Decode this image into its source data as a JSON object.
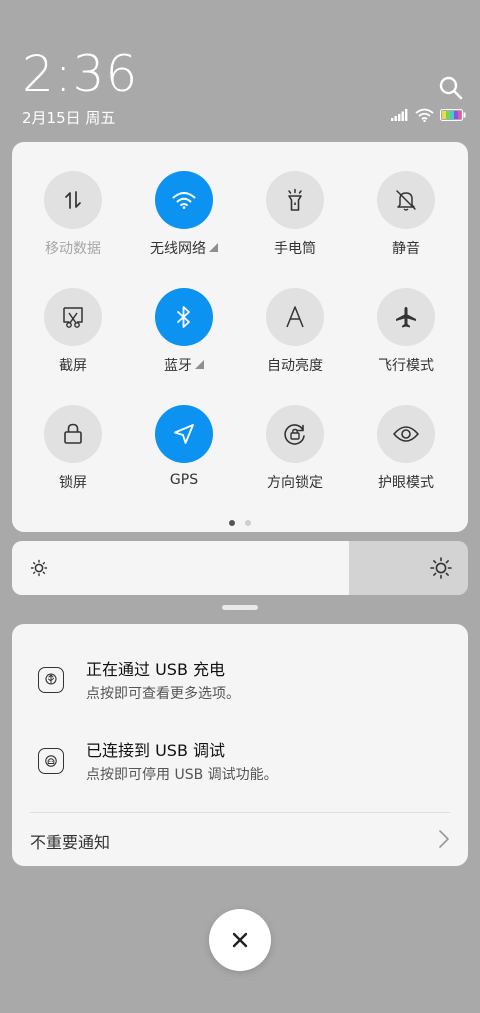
{
  "header": {
    "time": "2:36",
    "date": "2月15日 周五",
    "icons": [
      "search-icon",
      "signal-icon",
      "wifi-icon",
      "battery-icon"
    ]
  },
  "quick_settings": {
    "tiles": [
      {
        "label": "移动数据",
        "icon": "mobile-data-icon",
        "active": false,
        "disabled": true
      },
      {
        "label": "无线网络",
        "icon": "wifi-icon",
        "active": true,
        "has_menu": true
      },
      {
        "label": "手电筒",
        "icon": "flashlight-icon",
        "active": false
      },
      {
        "label": "静音",
        "icon": "mute-bell-icon",
        "active": false
      },
      {
        "label": "截屏",
        "icon": "screenshot-icon",
        "active": false
      },
      {
        "label": "蓝牙",
        "icon": "bluetooth-icon",
        "active": true,
        "has_menu": true
      },
      {
        "label": "自动亮度",
        "icon": "auto-brightness-icon",
        "active": false
      },
      {
        "label": "飞行模式",
        "icon": "airplane-icon",
        "active": false
      },
      {
        "label": "锁屏",
        "icon": "lock-icon",
        "active": false
      },
      {
        "label": "GPS",
        "icon": "location-arrow-icon",
        "active": true
      },
      {
        "label": "方向锁定",
        "icon": "rotation-lock-icon",
        "active": false
      },
      {
        "label": "护眼模式",
        "icon": "eye-icon",
        "active": false
      }
    ],
    "page_count": 2,
    "current_page": 1
  },
  "brightness": {
    "level": 0.74,
    "icons": [
      "brightness-low-icon",
      "brightness-high-icon"
    ]
  },
  "notifications": [
    {
      "title": "正在通过 USB 充电",
      "subtitle": "点按即可查看更多选项。",
      "icon": "usb-icon"
    },
    {
      "title": "已连接到 USB 调试",
      "subtitle": "点按即可停用 USB 调试功能。",
      "icon": "android-debug-icon"
    }
  ],
  "unimportant": {
    "label": "不重要通知"
  },
  "colors": {
    "accent": "#0c93f2",
    "background": "#a9a9a9",
    "panel": "#f5f5f5",
    "tile_off": "#e1e1e1"
  }
}
